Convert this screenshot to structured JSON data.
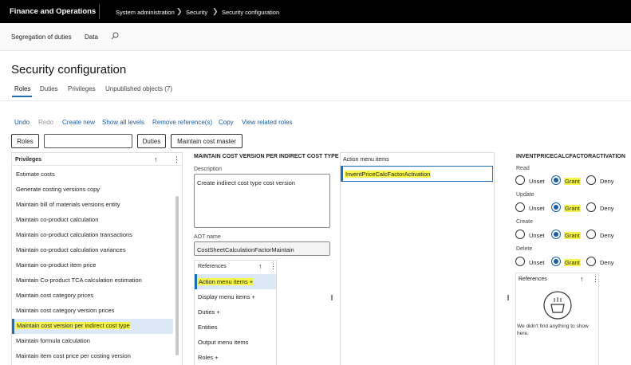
{
  "topbar": {
    "app_title": "Finance and Operations",
    "breadcrumb": [
      "System administration",
      "Security",
      "Security configuration"
    ]
  },
  "subbar": {
    "item1": "Segregation of duties",
    "item2": "Data"
  },
  "page": {
    "title": "Security configuration",
    "tabs": [
      "Roles",
      "Duties",
      "Privileges",
      "Unpublished objects (7)"
    ]
  },
  "actions": [
    "Undo",
    "Redo",
    "Create new",
    "Show all levels",
    "Remove reference(s)",
    "Copy",
    "View related roles"
  ],
  "toolbar": {
    "roles_button": "Roles",
    "duties_button": "Duties",
    "maintain_button": "Maintain cost master",
    "filter_value": ""
  },
  "privileges": {
    "header": "Privileges",
    "items": [
      "Estimate costs",
      "Generate costing versions copy",
      "Maintain bill of materials versions entity",
      "Maintain co-product calculation",
      "Maintain co-product calculation transactions",
      "Maintain co-product calculation variances",
      "Maintain co-product item price",
      "Maintain Co-product TCA calculation estimation",
      "Maintain cost category prices",
      "Maintain cost category version prices",
      "Maintain cost version per indirect cost type",
      "Maintain formula calculation",
      "Maintain item cost price per costing version"
    ],
    "selected_index": 10
  },
  "detail": {
    "header": "MAINTAIN COST VERSION PER INDIRECT COST TYPE",
    "description_label": "Description",
    "description_value": "Create indirect cost type cost version",
    "aot_label": "AOT name",
    "aot_value": "CostSheetCalculationFactorMaintain",
    "references_header": "References",
    "references": [
      "Action menu items +",
      "Display menu items +",
      "Duties +",
      "Entities",
      "Output menu items",
      "Roles +"
    ]
  },
  "action_menu": {
    "header": "Action menu items",
    "items": [
      "InventPriceCalcFactorActivation"
    ]
  },
  "permissions": {
    "header": "INVENTPRICECALCFACTORACTIVATION",
    "groups": [
      {
        "label": "Read",
        "options": [
          "Unset",
          "Grant",
          "Deny"
        ],
        "selected": "Grant"
      },
      {
        "label": "Update",
        "options": [
          "Unset",
          "Grant",
          "Deny"
        ],
        "selected": "Grant"
      },
      {
        "label": "Create",
        "options": [
          "Unset",
          "Grant",
          "Deny"
        ],
        "selected": "Grant"
      },
      {
        "label": "Delete",
        "options": [
          "Unset",
          "Grant",
          "Deny"
        ],
        "selected": "Grant"
      }
    ],
    "references_header": "References",
    "empty_text": "We didn't find anything to show here."
  },
  "colors": {
    "accent": "#1a6fb5",
    "highlight": "#f7f54a",
    "topbar": "#000000"
  }
}
